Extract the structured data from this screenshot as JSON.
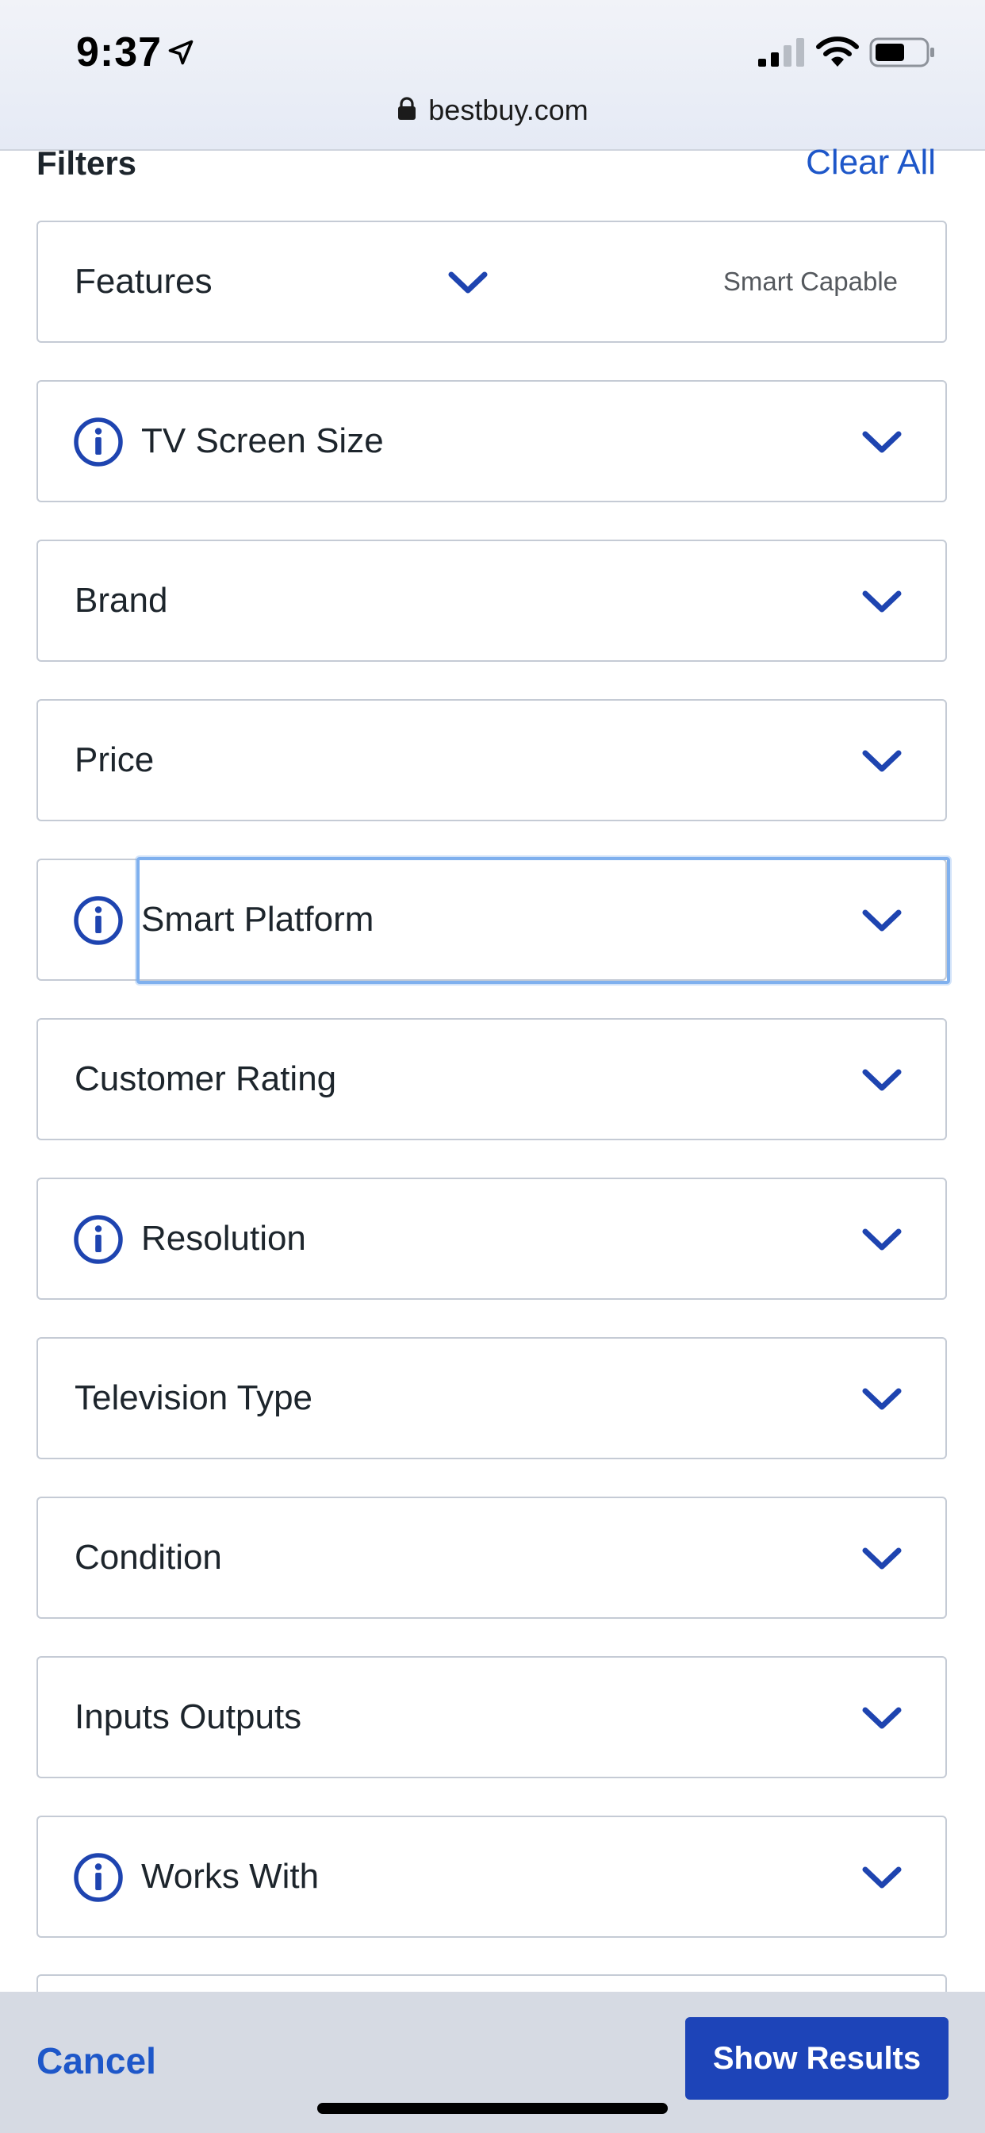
{
  "status_bar": {
    "time": "9:37"
  },
  "browser": {
    "url": "bestbuy.com"
  },
  "header": {
    "title": "Filters",
    "clear_all_label": "Clear All"
  },
  "filters": [
    {
      "label": "Features",
      "selected_value": "Smart Capable",
      "has_info": false
    },
    {
      "label": "TV Screen Size",
      "has_info": true
    },
    {
      "label": "Brand",
      "has_info": false
    },
    {
      "label": "Price",
      "has_info": false
    },
    {
      "label": "Smart Platform",
      "has_info": true,
      "focused": true
    },
    {
      "label": "Customer Rating",
      "has_info": false
    },
    {
      "label": "Resolution",
      "has_info": true
    },
    {
      "label": "Television Type",
      "has_info": false
    },
    {
      "label": "Condition",
      "has_info": false
    },
    {
      "label": "Inputs Outputs",
      "has_info": false
    },
    {
      "label": "Works With",
      "has_info": true
    }
  ],
  "footer": {
    "cancel_label": "Cancel",
    "show_results_label": "Show Results"
  },
  "colors": {
    "accent_blue": "#1e57c9",
    "button_blue": "#1d44b8",
    "focus_ring": "#7fb0ee",
    "border": "#c5cbd5"
  },
  "icons": {
    "info": "info-circle-icon",
    "chevron": "chevron-down-icon",
    "lock": "lock-icon"
  }
}
